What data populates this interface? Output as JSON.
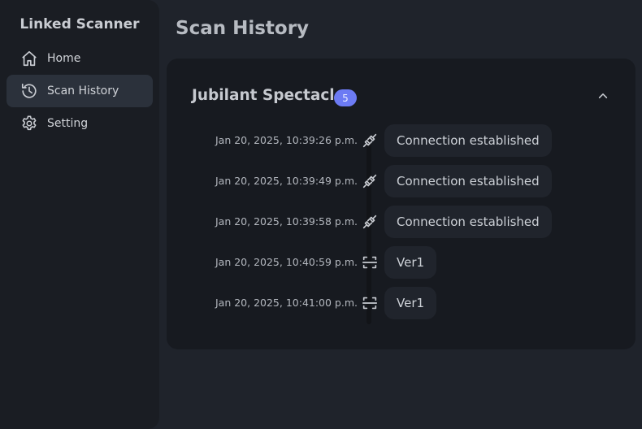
{
  "sidebar": {
    "brand": "Linked Scanner",
    "items": [
      {
        "label": "Home",
        "icon": "home-icon",
        "active": false
      },
      {
        "label": "Scan History",
        "icon": "history-icon",
        "active": true
      },
      {
        "label": "Setting",
        "icon": "gear-icon",
        "active": false
      }
    ]
  },
  "main": {
    "title": "Scan History",
    "group": {
      "name": "Jubilant Spectacle",
      "count": "5",
      "entries": [
        {
          "time": "Jan 20, 2025, 10:39:26 p.m.",
          "icon": "plug-icon",
          "message": "Connection established"
        },
        {
          "time": "Jan 20, 2025, 10:39:49 p.m.",
          "icon": "plug-icon",
          "message": "Connection established"
        },
        {
          "time": "Jan 20, 2025, 10:39:58 p.m.",
          "icon": "plug-icon",
          "message": "Connection established"
        },
        {
          "time": "Jan 20, 2025, 10:40:59 p.m.",
          "icon": "scan-icon",
          "message": "Ver1"
        },
        {
          "time": "Jan 20, 2025, 10:41:00 p.m.",
          "icon": "scan-icon",
          "message": "Ver1"
        }
      ]
    }
  },
  "colors": {
    "background": "#1f232b",
    "sidebar": "#1a1d23",
    "card": "#171a20",
    "accent_badge": "#6c7bf4",
    "active_nav": "#2b313b"
  }
}
